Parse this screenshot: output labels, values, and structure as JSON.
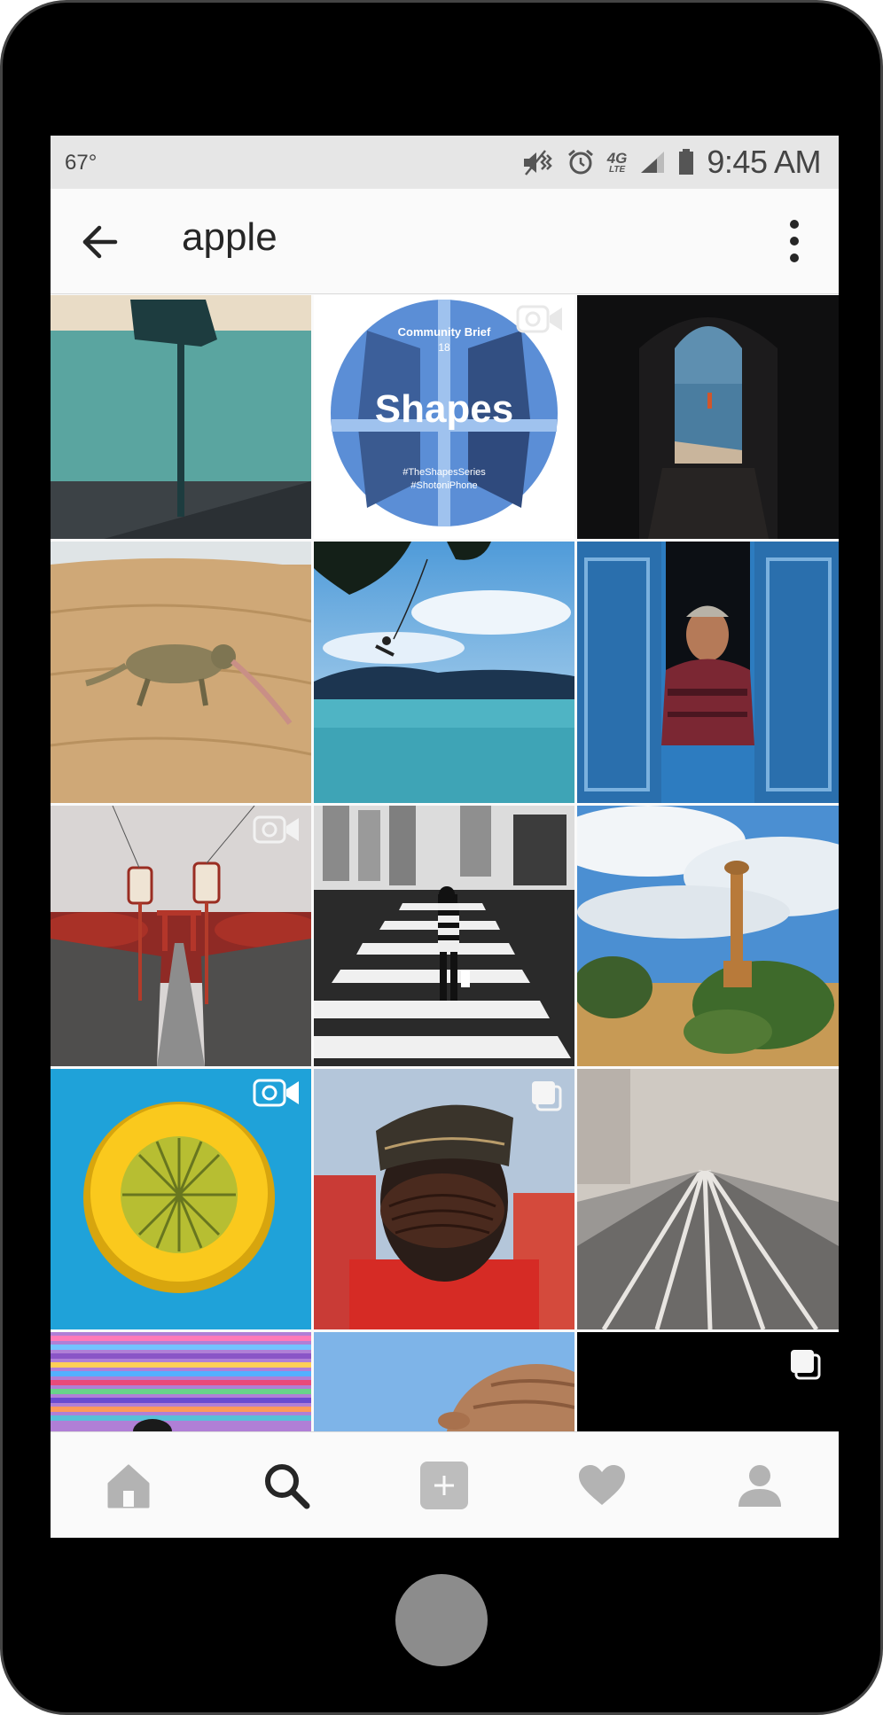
{
  "status_bar": {
    "temperature": "67°",
    "time": "9:45 AM",
    "network": "4G",
    "network_sub": "LTE",
    "icons": [
      "mute-vibrate-icon",
      "alarm-icon",
      "network-4g-lte-icon",
      "signal-icon",
      "battery-icon"
    ]
  },
  "app_bar": {
    "title": "apple",
    "back_icon": "arrow-left-icon",
    "menu_icon": "more-vertical-icon"
  },
  "grid": {
    "tiles": [
      {
        "name": "teal-wall-shadow",
        "overlay": ""
      },
      {
        "name": "shapes-community-brief",
        "overlay": "video-icon",
        "text_top": "Community Brief",
        "text_num": "18",
        "text_title": "Shapes",
        "text_tag1": "#TheShapesSeries",
        "text_tag2": "#ShotoniPhone"
      },
      {
        "name": "stone-arch-sea",
        "overlay": ""
      },
      {
        "name": "chameleon-sand",
        "overlay": ""
      },
      {
        "name": "rope-swing-lake",
        "overlay": ""
      },
      {
        "name": "man-blue-door",
        "overlay": ""
      },
      {
        "name": "japanese-bridge-lanterns",
        "overlay": "video-icon"
      },
      {
        "name": "crosswalk-bw",
        "overlay": ""
      },
      {
        "name": "giraffe-savanna",
        "overlay": ""
      },
      {
        "name": "melon-bowl",
        "overlay": "video-icon"
      },
      {
        "name": "hands-headscarf",
        "overlay": "carousel-icon"
      },
      {
        "name": "railway-tracks-fog",
        "overlay": ""
      },
      {
        "name": "rainbow-stripes",
        "overlay": ""
      },
      {
        "name": "rock-blue-sky",
        "overlay": ""
      },
      {
        "name": "black-carousel",
        "overlay": "carousel-icon"
      }
    ]
  },
  "bottom_nav": {
    "items": [
      {
        "name": "home",
        "icon": "home-icon",
        "active": false
      },
      {
        "name": "search",
        "icon": "search-icon",
        "active": true
      },
      {
        "name": "add",
        "icon": "add-icon",
        "active": false
      },
      {
        "name": "activity",
        "icon": "heart-icon",
        "active": false
      },
      {
        "name": "profile",
        "icon": "profile-icon",
        "active": false
      }
    ]
  },
  "colors": {
    "status_bar_bg": "#e6e6e6",
    "app_bg": "#fafafa",
    "text_primary": "#262626",
    "nav_inactive": "#b3b3b3",
    "nav_active": "#262626",
    "phone_frame": "#000000",
    "home_button": "#8c8c8c"
  }
}
